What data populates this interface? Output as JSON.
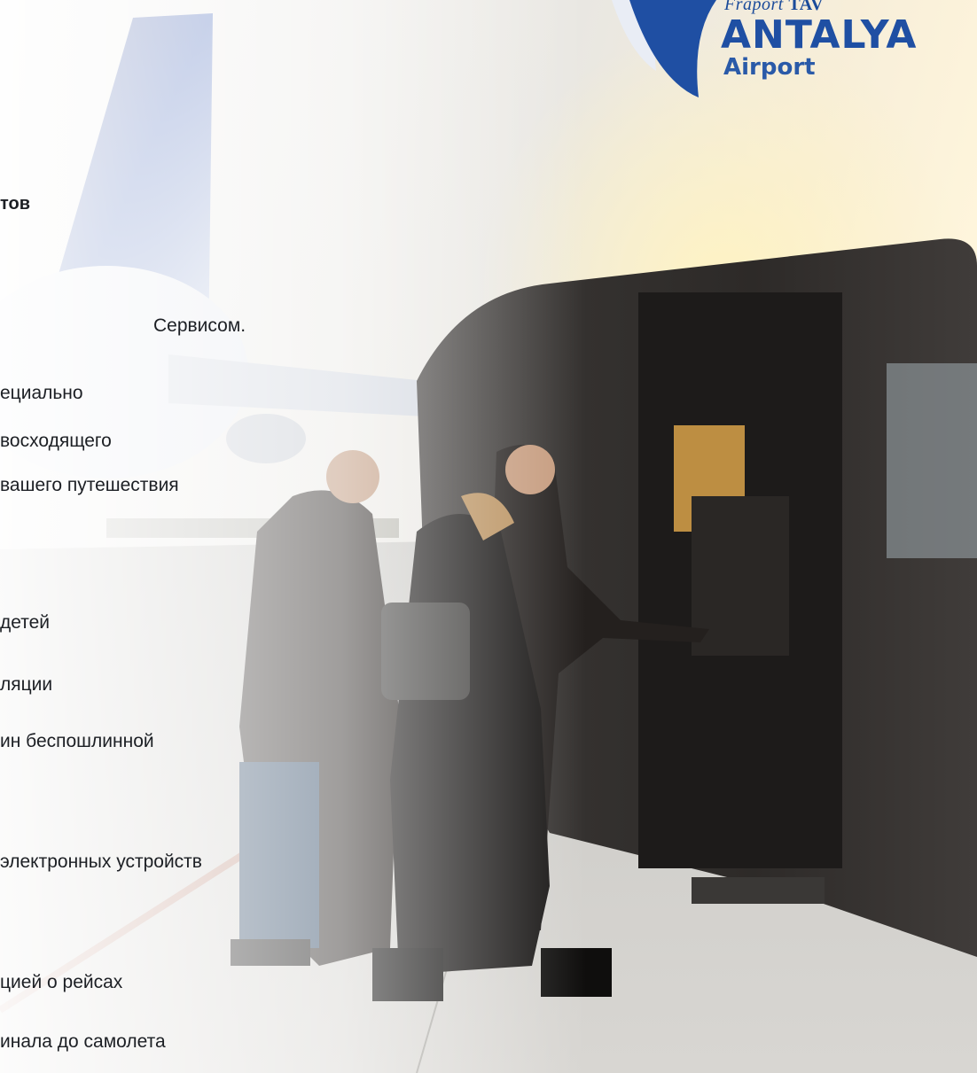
{
  "logo": {
    "brand_left": "Fraport",
    "brand_right": "TAV",
    "city": "ANTALYA",
    "airport": "Airport"
  },
  "heading": "тов",
  "intro_lines": [
    "Сервисом.",
    "ециально",
    "восходящего",
    "вашего путешествия"
  ],
  "features": [
    "детей",
    "ляции",
    "ин беспошлинной",
    "электронных устройств",
    "цией о рейсах",
    "инала до самолета"
  ],
  "colors": {
    "brand_blue": "#1f4fa3",
    "text": "#1c1f24"
  },
  "icons": {
    "logo_mark": "logo-swoosh-icon"
  }
}
